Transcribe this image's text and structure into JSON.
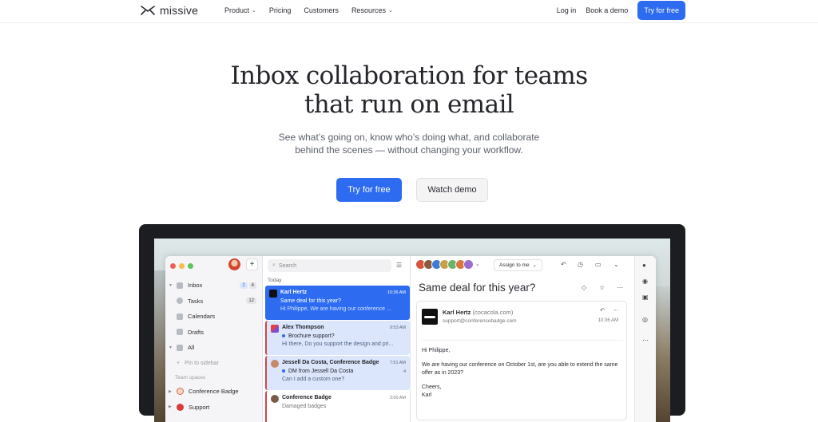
{
  "nav": {
    "brand": "missive",
    "links": [
      {
        "label": "Product",
        "has_menu": true
      },
      {
        "label": "Pricing",
        "has_menu": false
      },
      {
        "label": "Customers",
        "has_menu": false
      },
      {
        "label": "Resources",
        "has_menu": true
      }
    ],
    "login": "Log in",
    "book_demo": "Book a demo",
    "try_free": "Try for free"
  },
  "hero": {
    "title_line1": "Inbox collaboration for teams",
    "title_line2": "that run on email",
    "subtitle_line1": "See what’s going on, know who’s doing what, and collaborate",
    "subtitle_line2": "behind the scenes — without changing your workflow.",
    "cta_primary": "Try for free",
    "cta_secondary": "Watch demo"
  },
  "app": {
    "sidebar": {
      "items": [
        {
          "label": "Inbox",
          "counts": [
            "2",
            "4"
          ]
        },
        {
          "label": "Tasks",
          "counts": [
            "12"
          ]
        },
        {
          "label": "Calendars",
          "counts": []
        },
        {
          "label": "Drafts",
          "counts": []
        },
        {
          "label": "All",
          "counts": []
        }
      ],
      "pin": "Pin to sidebar",
      "section": "Team spaces",
      "teams": [
        "Conference Badge",
        "Support"
      ]
    },
    "list": {
      "search_placeholder": "Search",
      "day": "Today",
      "conversations": [
        {
          "from": "Karl Hertz",
          "time": "10:36 AM",
          "subject": "Same deal for this year?",
          "preview": "Hi Philippe, We are having our conference ..."
        },
        {
          "from": "Alex Thompson",
          "time": "9:53 AM",
          "subject": "Brochure support?",
          "preview": "Hi there, Do you support the design and pri..."
        },
        {
          "from": "Jessell Da Costa, Conference Badge",
          "time": "7:51 AM",
          "count": "4",
          "subject": "DM from Jessell Da Costa",
          "preview": "Can I add a custom one?"
        },
        {
          "from": "Conference Badge",
          "time": "3:00 AM",
          "subject": "Damaged badges",
          "preview": ""
        }
      ]
    },
    "reader": {
      "assign": "Assign to me",
      "subject": "Same deal for this year?",
      "sender_name": "Karl Hertz",
      "sender_domain": "(cocacola.com)",
      "sender_addr": "support@conferencebadge.com",
      "sent_time": "10:36 AM",
      "greeting": "Hi Philippe,",
      "body": "We are having our conference on October 1st, are you able to extend the same offer as in 2023?",
      "signoff": "Cheers,",
      "signature": "Karl"
    }
  },
  "colors": {
    "accent": "#2d6bf1",
    "frame": "#1c1d20",
    "selected_row": "#2d6bf1",
    "unread_row": "#dbe6fd"
  },
  "icons": [
    "missive-logo-icon",
    "chevron-down-icon",
    "search-icon",
    "filter-icon",
    "plus-icon",
    "inbox-icon",
    "tasks-icon",
    "calendar-icon",
    "drafts-icon",
    "archive-icon",
    "pin-icon",
    "tag-icon",
    "star-icon",
    "reply-icon",
    "clock-icon",
    "more-icon",
    "user-icon",
    "check-circle-icon",
    "globe-icon"
  ]
}
